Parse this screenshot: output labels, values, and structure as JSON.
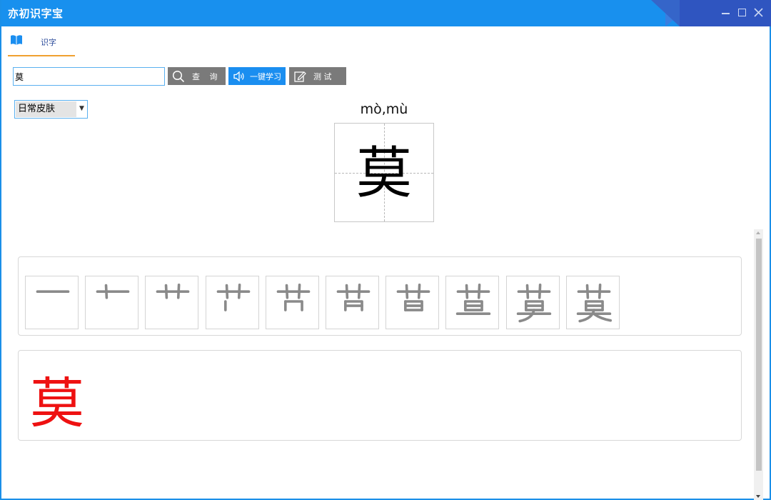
{
  "window": {
    "title": "亦初识字宝",
    "controls": [
      "minimize-icon",
      "maximize-icon",
      "close-icon"
    ],
    "accent_color": "#1890ee"
  },
  "tabs": [
    {
      "label": "识字",
      "icon": "book-icon",
      "active": true
    }
  ],
  "search": {
    "value": "莫"
  },
  "toolbar": {
    "query_label": "查 询",
    "learn_label": "一键学习",
    "test_label": "测 试",
    "query_icon": "search-icon",
    "learn_icon": "speaker-icon",
    "test_icon": "edit-icon"
  },
  "skin": {
    "selected": "日常皮肤"
  },
  "character": {
    "char": "莫",
    "pinyin": "mò,mù"
  },
  "strokes": {
    "count": 10,
    "stroke_color": "#8a8a8a"
  },
  "demo": {
    "char": "莫",
    "color": "#ee1111"
  }
}
